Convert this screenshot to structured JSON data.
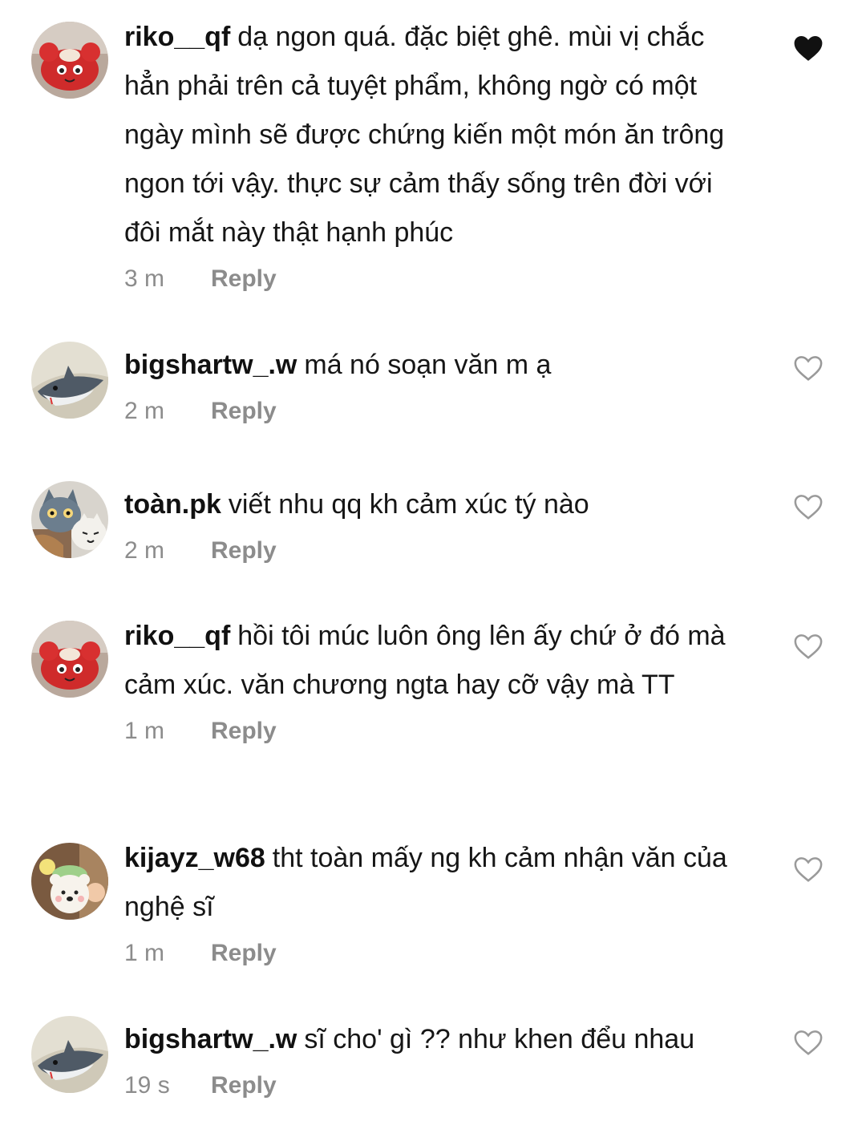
{
  "comments": [
    {
      "username": "riko__qf",
      "text": "dạ ngon quá. đặc biệt ghê. mùi vị chắc hẳn phải trên cả tuyệt phẩm, không ngờ có một ngày mình sẽ được chứng kiến một món ăn trông ngon tới vậy. thực sự cảm thấy sống trên đời với đôi mắt này thật hạnh phúc",
      "time": "3 m",
      "reply_label": "Reply",
      "liked": true,
      "avatar_icon": "red-crab-plush-avatar"
    },
    {
      "username": "bigshartw_.w",
      "text": "má nó soạn văn m ạ",
      "time": "2 m",
      "reply_label": "Reply",
      "liked": false,
      "avatar_icon": "shark-plush-avatar"
    },
    {
      "username": "toàn.pk",
      "text": "viết nhu qq kh cảm xúc tý nào",
      "time": "2 m",
      "reply_label": "Reply",
      "liked": false,
      "avatar_icon": "cat-plush-avatar"
    },
    {
      "username": "riko__qf",
      "text": "hồi tôi múc luôn ông lên ấy chứ ở đó mà cảm xúc. văn chương ngta hay cỡ vậy mà TT",
      "time": "1 m",
      "reply_label": "Reply",
      "liked": false,
      "avatar_icon": "red-crab-plush-avatar"
    },
    {
      "username": "kijayz_w68",
      "text": "tht toàn mấy ng kh cảm nhận văn của nghệ sĩ",
      "time": "1 m",
      "reply_label": "Reply",
      "liked": false,
      "avatar_icon": "bear-plush-avatar"
    },
    {
      "username": "bigshartw_.w",
      "text": "sĩ cho' gì ?? như khen đểu nhau",
      "time": "19 s",
      "reply_label": "Reply",
      "liked": false,
      "avatar_icon": "shark-plush-avatar"
    }
  ],
  "colors": {
    "text": "#161616",
    "meta": "#8c8c8c",
    "heart_outline": "#9a9a9a",
    "heart_filled": "#111111"
  }
}
